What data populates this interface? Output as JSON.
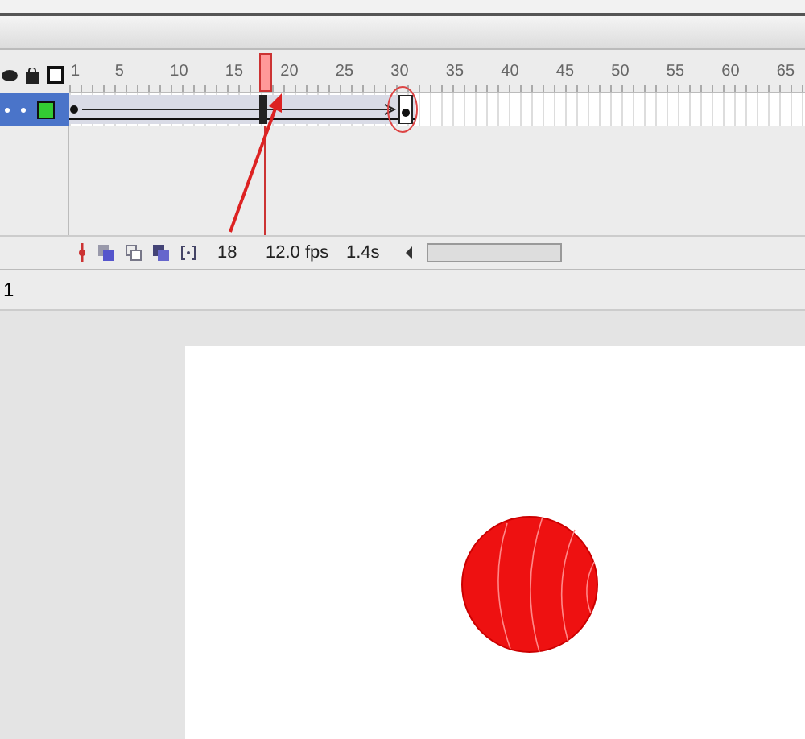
{
  "timeline": {
    "ruler": [
      "1",
      "5",
      "10",
      "15",
      "20",
      "25",
      "30",
      "35",
      "40",
      "45",
      "50",
      "55",
      "60",
      "65"
    ],
    "status": {
      "current_frame": "18",
      "fps": "12.0 fps",
      "elapsed": "1.4s"
    }
  },
  "scene_bar": {
    "scene": "1"
  }
}
